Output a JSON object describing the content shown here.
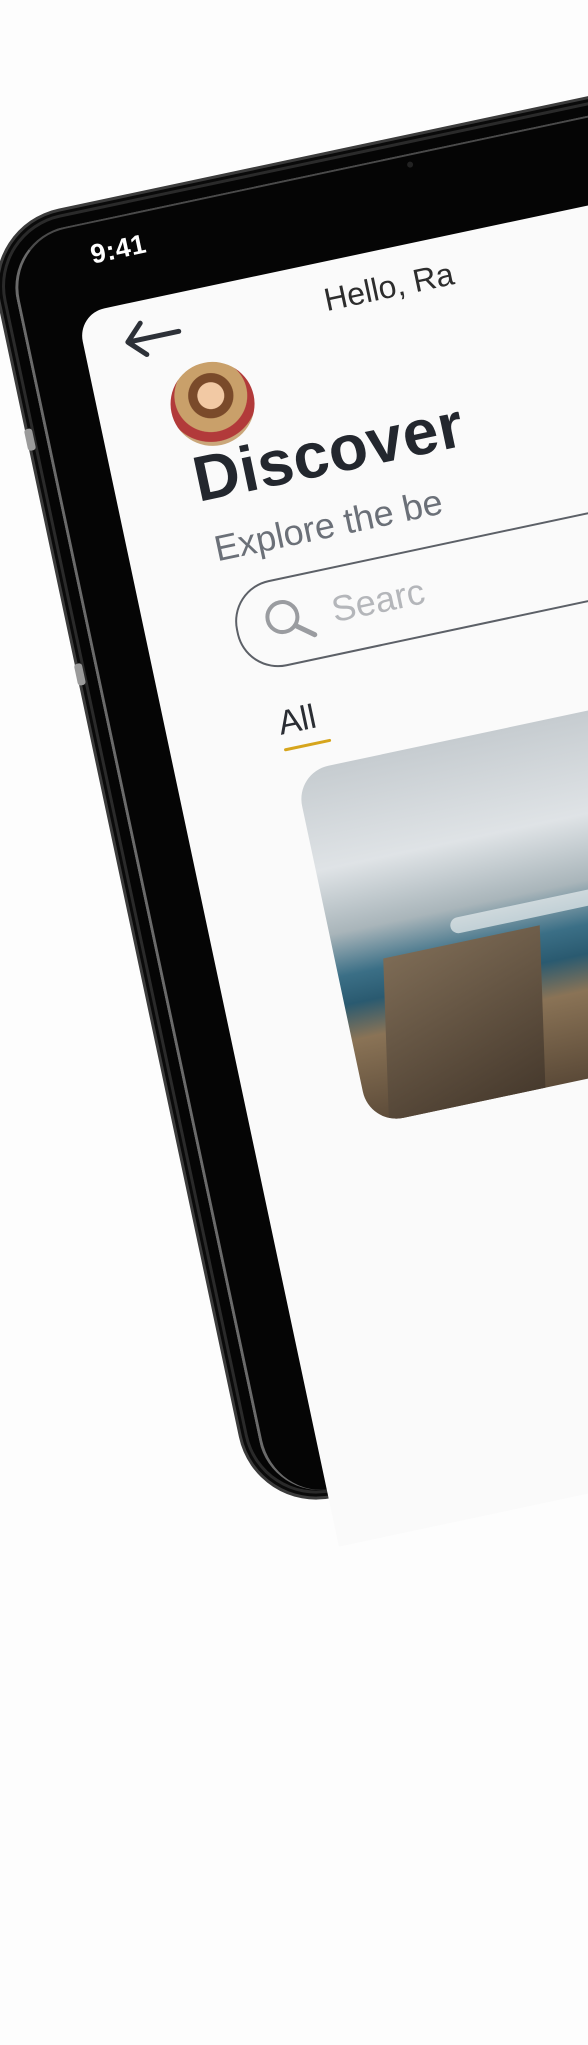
{
  "status_bar": {
    "time": "9:41"
  },
  "header": {
    "greeting": "Hello, Ra"
  },
  "main": {
    "title": "Discover",
    "subtitle": "Explore the be",
    "search": {
      "placeholder": "Searc"
    },
    "tabs": [
      {
        "label": "All",
        "active": true
      }
    ]
  },
  "icons": {
    "back": "arrow-left-icon",
    "search": "search-icon"
  },
  "colors": {
    "accent": "#d6a51c",
    "text": "#23272e",
    "muted": "#6b7078"
  }
}
